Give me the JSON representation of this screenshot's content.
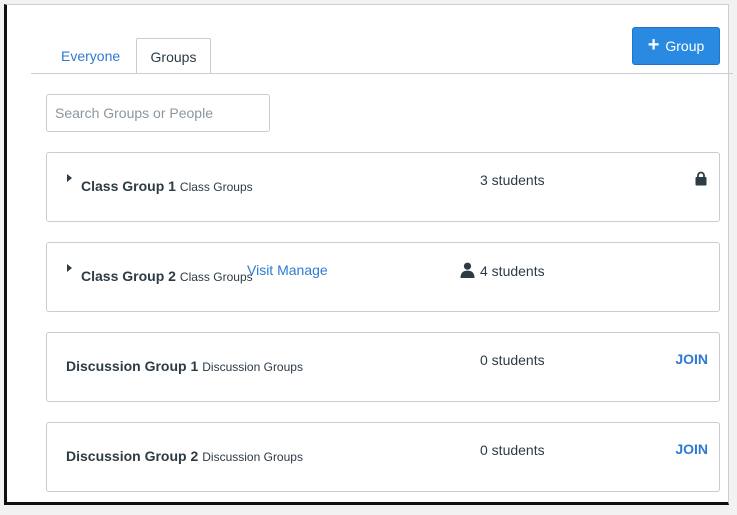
{
  "tabs": [
    {
      "label": "Everyone"
    },
    {
      "label": "Groups"
    }
  ],
  "add_group_button": {
    "icon": "plus-icon",
    "label": "Group"
  },
  "search": {
    "placeholder": "Search Groups or People",
    "value": ""
  },
  "groups": [
    {
      "name": "Class Group 1",
      "category": "Class Groups",
      "count": "3 students",
      "status_icon": "lock-icon"
    },
    {
      "name": "Class Group 2",
      "category": "Class Groups",
      "visit": "Visit",
      "manage": "Manage",
      "count": "4 students",
      "member_icon": "person-icon"
    },
    {
      "name": "Discussion Group 1",
      "category": "Discussion Groups",
      "count": "0 students",
      "action": "JOIN"
    },
    {
      "name": "Discussion Group 2",
      "category": "Discussion Groups",
      "count": "0 students",
      "action": "JOIN"
    }
  ],
  "colors": {
    "accent": "#2a8ae2",
    "link": "#2d7bd0",
    "text": "#2d3b45",
    "border": "#c7cdd1"
  }
}
